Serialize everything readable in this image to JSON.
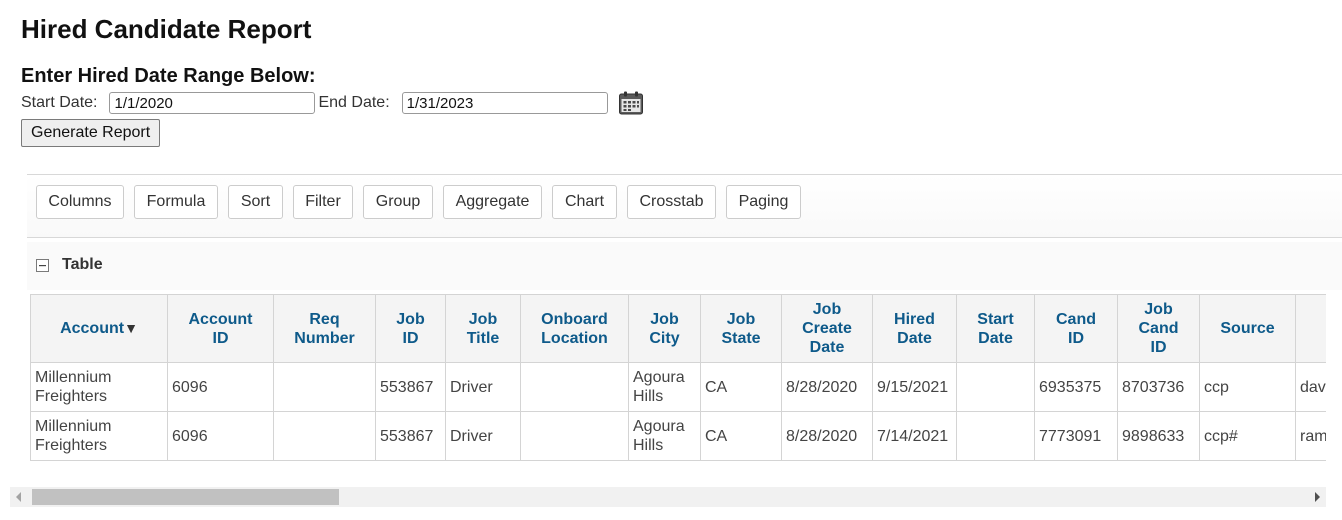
{
  "page": {
    "title": "Hired Candidate Report"
  },
  "date_range": {
    "heading": "Enter Hired Date Range Below:",
    "start_label": "Start Date:",
    "start_value": "1/1/2020",
    "end_label": "End Date:",
    "end_value": "1/31/2023",
    "calendar_icon": "calendar-icon"
  },
  "generate_button": "Generate Report",
  "toolbar": {
    "buttons": [
      "Columns",
      "Formula",
      "Sort",
      "Filter",
      "Group",
      "Aggregate",
      "Chart",
      "Crosstab",
      "Paging"
    ]
  },
  "table_section": {
    "label": "Table",
    "collapse_icon": "collapse-minus-icon"
  },
  "grid": {
    "sort_indicator": "▼",
    "columns": [
      {
        "line1": "Account",
        "line2": "",
        "line3": ""
      },
      {
        "line1": "Account",
        "line2": "ID",
        "line3": ""
      },
      {
        "line1": "Req",
        "line2": "Number",
        "line3": ""
      },
      {
        "line1": "Job",
        "line2": "ID",
        "line3": ""
      },
      {
        "line1": "Job",
        "line2": "Title",
        "line3": ""
      },
      {
        "line1": "Onboard",
        "line2": "Location",
        "line3": ""
      },
      {
        "line1": "Job",
        "line2": "City",
        "line3": ""
      },
      {
        "line1": "Job",
        "line2": "State",
        "line3": ""
      },
      {
        "line1": "Job",
        "line2": "Create",
        "line3": "Date"
      },
      {
        "line1": "Hired",
        "line2": "Date",
        "line3": ""
      },
      {
        "line1": "Start",
        "line2": "Date",
        "line3": ""
      },
      {
        "line1": "Cand",
        "line2": "ID",
        "line3": ""
      },
      {
        "line1": "Job",
        "line2": "Cand",
        "line3": "ID"
      },
      {
        "line1": "Source",
        "line2": "",
        "line3": ""
      },
      {
        "line1": "",
        "line2": "",
        "line3": ""
      }
    ],
    "rows": [
      {
        "account_l1": "Millennium",
        "account_l2": "Freighters",
        "account_id": "6096",
        "req_number": "",
        "job_id": "553867",
        "job_title": "Driver",
        "onboard_location": "",
        "city_l1": "Agoura",
        "city_l2": "Hills",
        "state": "CA",
        "create_date": "8/28/2020",
        "hired_date": "9/15/2021",
        "start_date": "",
        "cand_id": "6935375",
        "job_cand_id": "8703736",
        "source": "ccp",
        "extra": "dav"
      },
      {
        "account_l1": "Millennium",
        "account_l2": "Freighters",
        "account_id": "6096",
        "req_number": "",
        "job_id": "553867",
        "job_title": "Driver",
        "onboard_location": "",
        "city_l1": "Agoura",
        "city_l2": "Hills",
        "state": "CA",
        "create_date": "8/28/2020",
        "hired_date": "7/14/2021",
        "start_date": "",
        "cand_id": "7773091",
        "job_cand_id": "9898633",
        "source": "ccp#",
        "extra": "ram"
      }
    ]
  },
  "scrollbar": {
    "position_fraction": 0.0
  }
}
